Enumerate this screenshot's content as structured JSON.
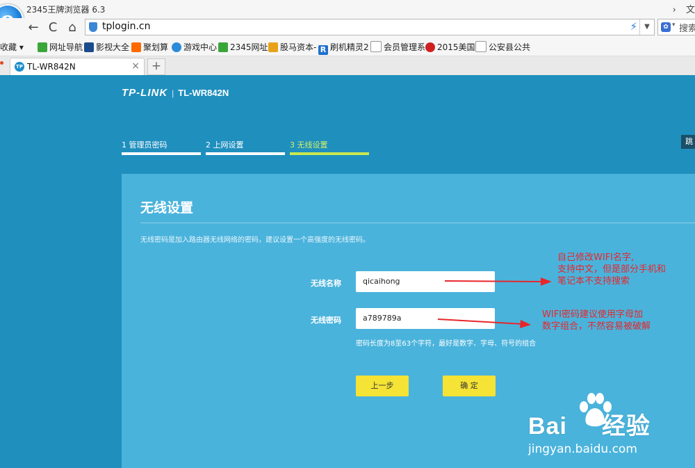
{
  "browser": {
    "title": "2345王牌浏览器 6.3",
    "titlebar_right": [
      "›",
      "文"
    ],
    "logo_letter": "e",
    "url": "tplogin.cn",
    "search_placeholder": "搜索"
  },
  "nav": {
    "back": "←",
    "forward": "→",
    "reload": "C",
    "home": "⌂"
  },
  "bookmarks": [
    {
      "label": "收藏",
      "icon_color": ""
    },
    {
      "label": "网址导航",
      "icon_color": "#3aa63a"
    },
    {
      "label": "影视大全",
      "icon_color": "#1a4b8c"
    },
    {
      "label": "聚划算",
      "icon_color": "#ff6a00"
    },
    {
      "label": "游戏中心",
      "icon_color": "#2b8bd8"
    },
    {
      "label": "2345网址",
      "icon_color": "#3aa63a"
    },
    {
      "label": "股马资本-",
      "icon_color": "#e8a21a"
    },
    {
      "label": "刷机精灵2",
      "icon_color": "#1f6fd1"
    },
    {
      "label": "会员管理系",
      "icon_color": "#ffffff"
    },
    {
      "label": "2015美国",
      "icon_color": "#d12020"
    },
    {
      "label": "公安县公共",
      "icon_color": "#ffffff"
    }
  ],
  "tab": {
    "favicon_text": "TP",
    "label": "TL-WR842N",
    "close": "×",
    "new_tab": "+"
  },
  "router": {
    "brand": "TP-LINK",
    "separator": "|",
    "model": "TL-WR842N",
    "steps": [
      {
        "label": "1 管理员密码",
        "active": false
      },
      {
        "label": "2 上网设置",
        "active": false
      },
      {
        "label": "3 无线设置",
        "active": true
      }
    ],
    "skip": "跳",
    "panel_title": "无线设置",
    "panel_desc": "无线密码是加入路由器无线网络的密码，建议设置一个高强度的无线密码。",
    "ssid_label": "无线名称",
    "ssid_value": "qicaihong",
    "password_label": "无线密码",
    "password_value": "a789789a",
    "password_hint": "密码长度为8至63个字符，最好是数字、字母、符号的组合",
    "prev_button": "上一步",
    "ok_button": "确 定"
  },
  "annotations": {
    "ssid_note": [
      "自己修改WIFI名字,",
      "支持中文，但是部分手机和",
      "笔记本不支持搜索"
    ],
    "password_note": [
      "WIFI密码建议使用字母加",
      "数字组合，不然容易被破解"
    ],
    "color": "#e8262a"
  },
  "watermark": {
    "word_left": "Bai",
    "word_right": "经验",
    "site": "jingyan.baidu.com"
  },
  "colors": {
    "page_bg": "#1f8fbe",
    "panel_bg": "#4ab3dc",
    "active_step": "#c9e84e",
    "button_yellow": "#f5e335"
  }
}
